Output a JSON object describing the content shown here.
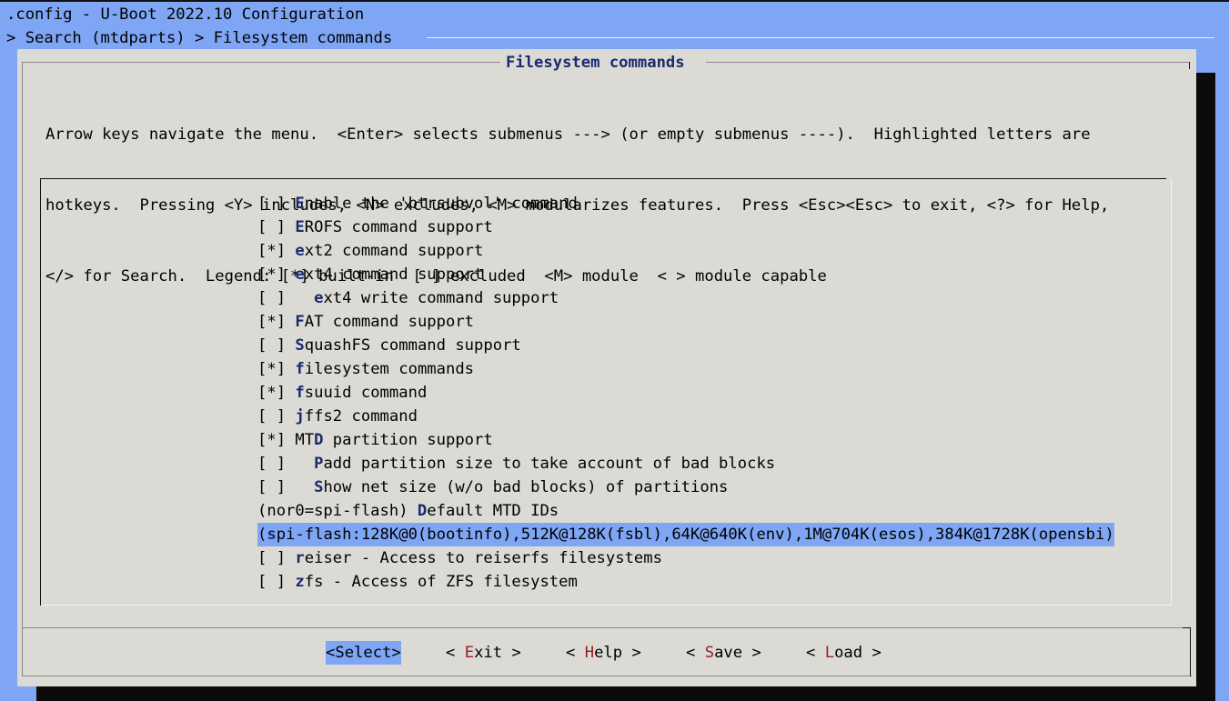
{
  "window": {
    "title": ".config - U-Boot 2022.10 Configuration",
    "breadcrumb": "> Search (mtdparts) > Filesystem commands"
  },
  "dialog": {
    "title": "Filesystem commands",
    "help_lines": [
      "Arrow keys navigate the menu.  <Enter> selects submenus ---> (or empty submenus ----).  Highlighted letters are",
      "hotkeys.  Pressing <Y> includes, <N> excludes, <M> modularizes features.  Press <Esc><Esc> to exit, <?> for Help,",
      "</> for Search.  Legend: [*] built-in  [ ] excluded  <M> module  < > module capable"
    ]
  },
  "menu": {
    "items": [
      {
        "prefix": "[ ] ",
        "hotkey": "E",
        "rest": "nable the 'btrsubvol' command",
        "selected": false
      },
      {
        "prefix": "[ ] ",
        "hotkey": "E",
        "rest": "ROFS command support",
        "selected": false
      },
      {
        "prefix": "[*] ",
        "hotkey": "e",
        "rest": "xt2 command support",
        "selected": false
      },
      {
        "prefix": "[*] ",
        "hotkey": "e",
        "rest": "xt4 command support",
        "selected": false
      },
      {
        "prefix": "[ ]   ",
        "hotkey": "e",
        "rest": "xt4 write command support",
        "selected": false
      },
      {
        "prefix": "[*] ",
        "hotkey": "F",
        "rest": "AT command support",
        "selected": false
      },
      {
        "prefix": "[ ] ",
        "hotkey": "S",
        "rest": "quashFS command support",
        "selected": false
      },
      {
        "prefix": "[*] ",
        "hotkey": "f",
        "rest": "ilesystem commands",
        "selected": false
      },
      {
        "prefix": "[*] ",
        "hotkey": "f",
        "rest": "suuid command",
        "selected": false
      },
      {
        "prefix": "[ ] ",
        "hotkey": "j",
        "rest": "ffs2 command",
        "selected": false
      },
      {
        "prefix": "[*] MT",
        "hotkey": "D",
        "rest": " partition support",
        "selected": false
      },
      {
        "prefix": "[ ]   ",
        "hotkey": "P",
        "rest": "add partition size to take account of bad blocks",
        "selected": false
      },
      {
        "prefix": "[ ]   ",
        "hotkey": "S",
        "rest": "how net size (w/o bad blocks) of partitions",
        "selected": false
      },
      {
        "prefix": "(nor0=spi-flash) ",
        "hotkey": "D",
        "rest": "efault MTD IDs",
        "selected": false
      },
      {
        "prefix": "(",
        "hotkey": "s",
        "rest": "pi-flash:128K@0(bootinfo),512K@128K(fsbl),64K@640K(env),1M@704K(esos),384K@1728K(opensbi)",
        "selected": true
      },
      {
        "prefix": "[ ] ",
        "hotkey": "r",
        "rest": "eiser - Access to reiserfs filesystems",
        "selected": false
      },
      {
        "prefix": "[ ] ",
        "hotkey": "z",
        "rest": "fs - Access of ZFS filesystem",
        "selected": false
      }
    ]
  },
  "buttons": [
    {
      "name": "select",
      "pre": "<",
      "hot": "S",
      "post": "elect>",
      "active": true
    },
    {
      "name": "exit",
      "pre": "< ",
      "hot": "E",
      "post": "xit >",
      "active": false
    },
    {
      "name": "help",
      "pre": "< ",
      "hot": "H",
      "post": "elp >",
      "active": false
    },
    {
      "name": "save",
      "pre": "< ",
      "hot": "S",
      "post": "ave >",
      "active": false
    },
    {
      "name": "load",
      "pre": "< ",
      "hot": "L",
      "post": "oad >",
      "active": false
    }
  ],
  "colors": {
    "background": "#7ea6f4",
    "dialog": "#dcdad5",
    "hotkey": "#1a2a6e",
    "button_hotkey": "#9b1c1c",
    "highlight": "#7ea6f4"
  }
}
